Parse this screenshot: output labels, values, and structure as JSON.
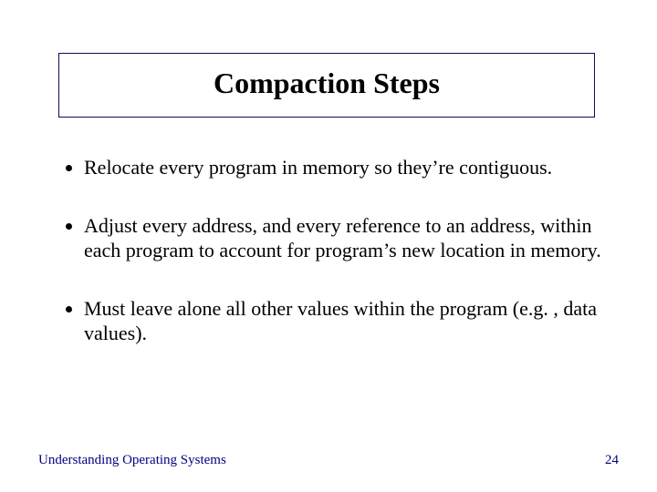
{
  "title": "Compaction Steps",
  "bullets": [
    "Relocate every program in memory so they’re contiguous.",
    "Adjust every address, and every reference to an address, within each program to account for program’s new location in memory.",
    "Must leave alone all other values within the program (e.g. , data values)."
  ],
  "footer_left": "Understanding Operating Systems",
  "footer_right": "24"
}
